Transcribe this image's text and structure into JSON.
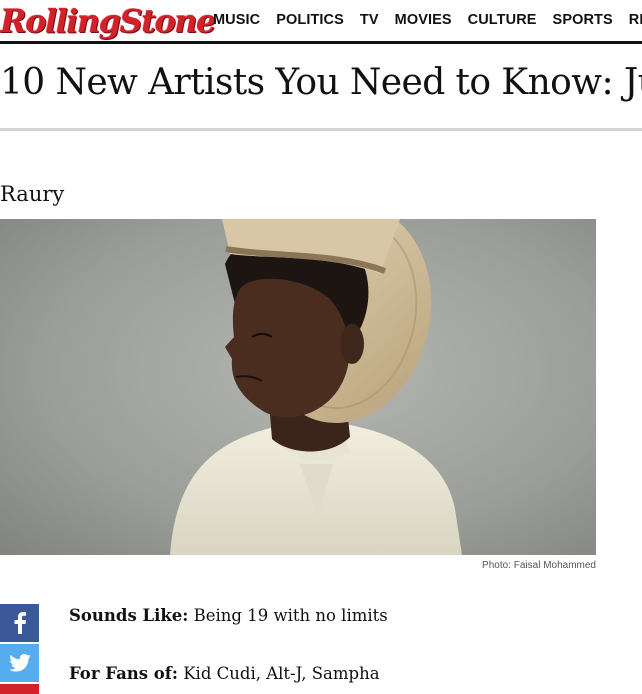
{
  "header": {
    "logo_text": "RollingStone",
    "nav": [
      "MUSIC",
      "POLITICS",
      "TV",
      "MOVIES",
      "CULTURE",
      "SPORTS",
      "RE"
    ],
    "brand_color": "#d3212a"
  },
  "article": {
    "title": "10 New Artists You Need to Know: Ju",
    "artist": "Raury",
    "photo_caption": "Photo: Faisal Mohammed",
    "details": [
      {
        "label": "Sounds Like:",
        "value": " Being 19 with no limits"
      },
      {
        "label": "For Fans of:",
        "value": " Kid Cudi, Alt-J, Sampha"
      }
    ]
  },
  "share": {
    "facebook_icon": "facebook-icon",
    "twitter_icon": "twitter-icon",
    "facebook_color": "#3b5998",
    "twitter_color": "#55acee"
  }
}
